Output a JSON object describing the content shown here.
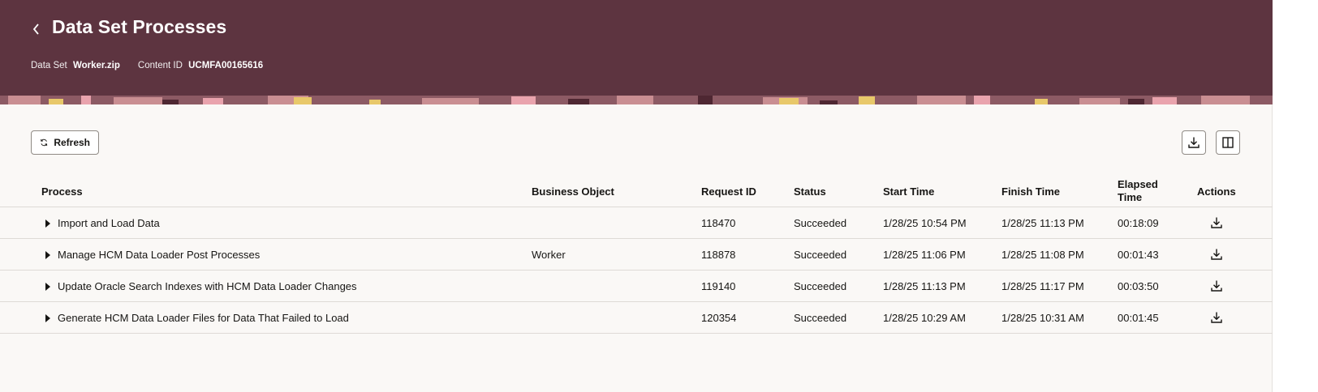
{
  "header": {
    "title": "Data Set Processes",
    "data_set_label": "Data Set",
    "data_set_value": "Worker.zip",
    "content_id_label": "Content ID",
    "content_id_value": "UCMFA00165616"
  },
  "toolbar": {
    "refresh_label": "Refresh"
  },
  "table": {
    "columns": {
      "process": "Process",
      "business_object": "Business Object",
      "request_id": "Request ID",
      "status": "Status",
      "start_time": "Start Time",
      "finish_time": "Finish Time",
      "elapsed_line1": "Elapsed",
      "elapsed_line2": "Time",
      "actions": "Actions"
    },
    "rows": [
      {
        "process": "Import and Load Data",
        "business_object": "",
        "request_id": "118470",
        "status": "Succeeded",
        "start_time": "1/28/25 10:54 PM",
        "finish_time": "1/28/25 11:13 PM",
        "elapsed": "00:18:09"
      },
      {
        "process": "Manage HCM Data Loader Post Processes",
        "business_object": "Worker",
        "request_id": "118878",
        "status": "Succeeded",
        "start_time": "1/28/25 11:06 PM",
        "finish_time": "1/28/25 11:08 PM",
        "elapsed": "00:01:43"
      },
      {
        "process": "Update Oracle Search Indexes with HCM Data Loader Changes",
        "business_object": "",
        "request_id": "119140",
        "status": "Succeeded",
        "start_time": "1/28/25 11:13 PM",
        "finish_time": "1/28/25 11:17 PM",
        "elapsed": "00:03:50"
      },
      {
        "process": "Generate HCM Data Loader Files for Data That Failed to Load",
        "business_object": "",
        "request_id": "120354",
        "status": "Succeeded",
        "start_time": "1/28/25 10:29 AM",
        "finish_time": "1/28/25 10:31 AM",
        "elapsed": "00:01:45"
      }
    ]
  },
  "icons": {
    "back": "chevron-left-icon",
    "refresh": "refresh-icon",
    "download": "download-icon",
    "columns": "columns-icon",
    "expand": "caret-right-icon"
  },
  "colors": {
    "header_bg": "#5d3440",
    "page_bg": "#faf8f6",
    "text": "#161513"
  }
}
